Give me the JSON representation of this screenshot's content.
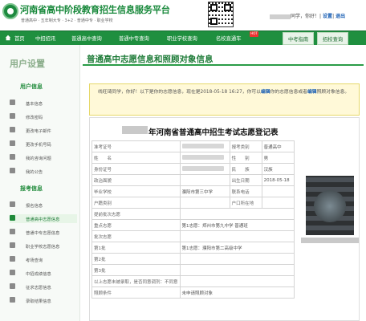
{
  "header": {
    "site_title": "河南省高中阶段教育招生信息服务平台",
    "site_subtitle": "普通高中 · 五年制大专 · 3+2 · 普通中专 · 职业学校",
    "user_suffix": "同学，你好！",
    "settings_link": "设置",
    "logout_link": "退出"
  },
  "nav": {
    "items": [
      "首页",
      "中招招讯",
      "普通高中查询",
      "普通中专查询",
      "职业学校查询",
      "名校直通车",
      "中考指南",
      "招校查询"
    ],
    "hot_badge": "HOT"
  },
  "sidebar": {
    "title": "用户设置",
    "sections": [
      {
        "title": "用户信息",
        "items": [
          "基本信息",
          "修改密码",
          "更改电子邮件",
          "更改手机号码",
          "我的咨询问题",
          "我的公告"
        ]
      },
      {
        "title": "报考信息",
        "items": [
          "报名信息",
          "普通高中志愿信息",
          "普通中专志愿信息",
          "职业学校志愿信息",
          "考场查询",
          "中招成绩信息",
          "征求志愿信息",
          "录取结果信息"
        ]
      }
    ]
  },
  "main": {
    "page_title": "普通高中志愿信息和照顾对象信息",
    "notice": {
      "greeting": "线旺琦同学，你好！以下是你的志愿信息，现在是2018-05-18 16:27，你可以",
      "link1": "编辑",
      "text2": "你的志愿信息或者",
      "link2": "编辑",
      "text3": "照顾对象信息。"
    },
    "form_title": "年河南省普通高中招生考试志愿登记表",
    "rows": [
      {
        "l1": "准考证号",
        "v1": "",
        "l2": "报考类别",
        "v2": "普通高中"
      },
      {
        "l1": "姓　　名",
        "v1": "",
        "l2": "性　　别",
        "v2": "男"
      },
      {
        "l1": "身份证号",
        "v1": "",
        "l2": "民　　族",
        "v2": "汉族"
      },
      {
        "l1": "政治面貌",
        "v1": "",
        "l2": "出生日期",
        "v2": "2018-05-18"
      },
      {
        "l1": "毕业学校",
        "v1": "濮阳市第三中学",
        "l2": "联系电话",
        "v2": ""
      },
      {
        "l1": "户籍类别",
        "v1": "",
        "l2": "户口所在地",
        "v2": ""
      },
      {
        "l1": "提前批次志愿",
        "v1": "",
        "l2": "",
        "v2": ""
      },
      {
        "l1": "重点志愿",
        "v1": "第1志愿：郑州市第九中学 普通班",
        "l2": "",
        "v2": ""
      },
      {
        "l1": "批次志愿",
        "v1": "",
        "l2": "",
        "v2": ""
      },
      {
        "l1": "第1批",
        "v1": "第1志愿：濮阳市第二高级中学",
        "l2": "",
        "v2": ""
      },
      {
        "l1": "第2批",
        "v1": "",
        "l2": "",
        "v2": ""
      },
      {
        "l1": "第3批",
        "v1": "",
        "l2": "",
        "v2": ""
      },
      {
        "l1": "以上志愿未被录取，是否同意调剂：不同意",
        "v1": "",
        "l2": "",
        "v2": ""
      },
      {
        "l1": "照顾条件",
        "v1": "未申请照顾对象",
        "l2": "",
        "v2": ""
      }
    ]
  }
}
